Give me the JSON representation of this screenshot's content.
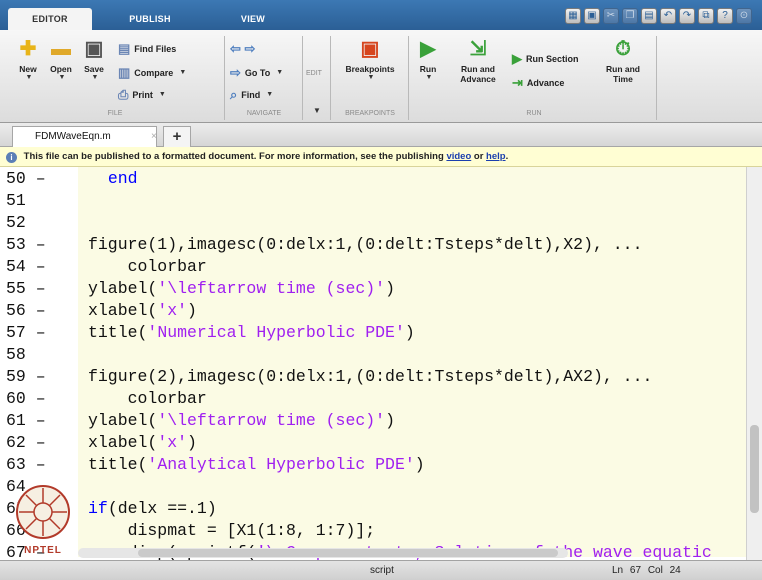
{
  "tabs": [
    "EDITOR",
    "PUBLISH",
    "VIEW"
  ],
  "ribbon": {
    "file": {
      "new": "New",
      "open": "Open",
      "save": "Save",
      "find_files": "Find Files",
      "compare": "Compare",
      "print": "Print",
      "group": "FILE"
    },
    "navigate": {
      "go_to": "Go To",
      "find": "Find",
      "group": "NAVIGATE"
    },
    "edit": {
      "group": "EDIT"
    },
    "breakpoints": {
      "button": "Breakpoints",
      "group": "BREAKPOINTS"
    },
    "run": {
      "run": "Run",
      "run_and_advance": "Run and Advance",
      "run_section": "Run Section",
      "advance": "Advance",
      "run_and_time": "Run and Time",
      "group": "RUN"
    }
  },
  "file_tab": {
    "name": "FDMWaveEqn.m",
    "close": "×",
    "new_tab": "+"
  },
  "info_bar": {
    "message": "This file can be published to a formatted document. For more information, see the publishing",
    "link_video": "video",
    "or": "or",
    "link_help": "help",
    "end": "."
  },
  "code_lines": [
    {
      "num": "50 –",
      "text": "  end",
      "kind": "kw-end"
    },
    {
      "num": "51",
      "text": "",
      "kind": "plain"
    },
    {
      "num": "52",
      "text": "",
      "kind": "plain"
    },
    {
      "num": "53 –",
      "text": "figure(1),imagesc(0:delx:1,(0:delt:Tsteps*delt),X2), ...",
      "kind": "plain"
    },
    {
      "num": "54 –",
      "text": "    colorbar",
      "kind": "plain"
    },
    {
      "num": "55 –",
      "text": "ylabel('\\leftarrow time (sec)')",
      "kind": "str"
    },
    {
      "num": "56 –",
      "text": "xlabel('x')",
      "kind": "str"
    },
    {
      "num": "57 –",
      "text": "title('Numerical Hyperbolic PDE')",
      "kind": "str"
    },
    {
      "num": "58",
      "text": "",
      "kind": "plain"
    },
    {
      "num": "59 –",
      "text": "figure(2),imagesc(0:delx:1,(0:delt:Tsteps*delt),AX2), ...",
      "kind": "plain"
    },
    {
      "num": "60 –",
      "text": "    colorbar",
      "kind": "plain"
    },
    {
      "num": "61 –",
      "text": "ylabel('\\leftarrow time (sec)')",
      "kind": "str"
    },
    {
      "num": "62 –",
      "text": "xlabel('x')",
      "kind": "str"
    },
    {
      "num": "63 –",
      "text": "title('Analytical Hyperbolic PDE')",
      "kind": "str"
    },
    {
      "num": "64",
      "text": "",
      "kind": "plain"
    },
    {
      "num": "65 –",
      "text": "if(delx ==.1)",
      "kind": "kw-if"
    },
    {
      "num": "66 –",
      "text": "    dispmat = [X1(1:8, 1:7)];",
      "kind": "plain"
    },
    {
      "num": "67 –",
      "text": "    disp(sprintf('\\nCompare to ta, Solution of the wave equatic",
      "kind": "str"
    }
  ],
  "status_bar": {
    "mode": "script",
    "ln_label": "Ln",
    "ln": "67",
    "col_label": "Col",
    "col": "24"
  },
  "logo": {
    "text": "NPTEL"
  },
  "colors": {
    "keyword": "#0000ff",
    "string": "#a020f0",
    "tabstrip": "#3c78b4",
    "cell_band": "#fbfbe4"
  }
}
